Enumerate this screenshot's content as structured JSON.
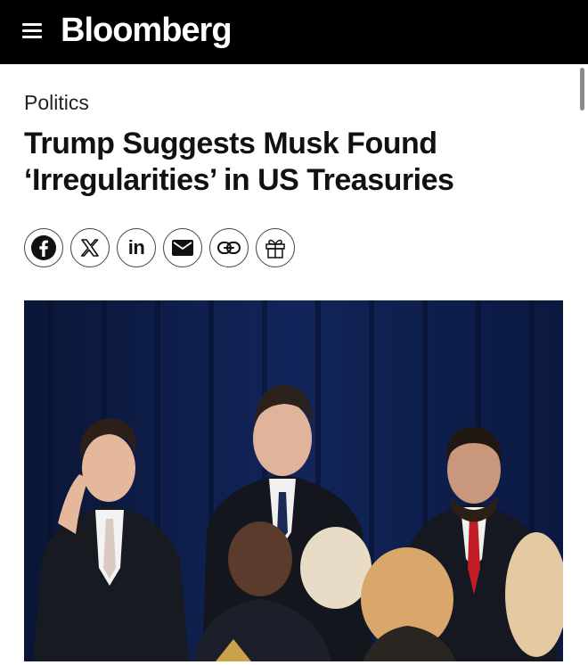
{
  "header": {
    "logo_text": "Bloomberg",
    "background": "#000000",
    "menu_icon": "hamburger-menu-icon"
  },
  "article": {
    "section": "Politics",
    "headline_line1": "Trump Suggests Musk Found",
    "headline_line2": "‘Irregularities’ in US Treasuries"
  },
  "share_buttons": [
    {
      "name": "facebook",
      "icon": "facebook-icon"
    },
    {
      "name": "x",
      "icon": "x-icon"
    },
    {
      "name": "linkedin",
      "icon": "linkedin-icon",
      "label": "in"
    },
    {
      "name": "email",
      "icon": "email-icon"
    },
    {
      "name": "copy-link",
      "icon": "link-icon"
    },
    {
      "name": "gift",
      "icon": "gift-icon"
    }
  ],
  "photo": {
    "subject": "people-in-front-of-blue-curtain",
    "background_color": "#0b1a3c"
  }
}
